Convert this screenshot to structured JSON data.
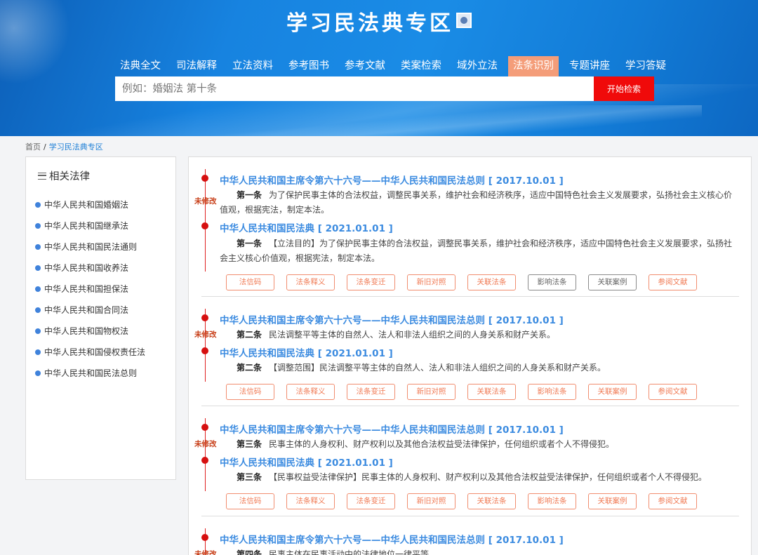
{
  "banner": {
    "title": "学习民法典专区",
    "nav": [
      "法典全文",
      "司法解释",
      "立法资料",
      "参考图书",
      "参考文献",
      "类案检索",
      "域外立法",
      "法条识别",
      "专题讲座",
      "学习答疑"
    ],
    "active_nav": "法条识别",
    "search_placeholder": "例如：婚姻法 第十条",
    "search_button": "开始检索"
  },
  "colors": {
    "accent": "#1a8ce6",
    "active_nav": "#f49d79",
    "search_button": "#f00a0a",
    "link": "#3b8be0",
    "status": "#c8401a"
  },
  "breadcrumb": {
    "home": "首页",
    "separator": "/",
    "current": "学习民法典专区"
  },
  "sidebar": {
    "title": "相关法律",
    "items": [
      "中华人民共和国婚姻法",
      "中华人民共和国继承法",
      "中华人民共和国民法通则",
      "中华人民共和国收养法",
      "中华人民共和国担保法",
      "中华人民共和国合同法",
      "中华人民共和国物权法",
      "中华人民共和国侵权责任法",
      "中华人民共和国民法总则"
    ]
  },
  "articles": [
    {
      "status": "未修改",
      "old_title": "中华人民共和国主席令第六十六号——中华人民共和国民法总则 [ 2017.10.01 ]",
      "old_article_no": "第一条",
      "old_text": "为了保护民事主体的合法权益，调整民事关系，维护社会和经济秩序，适应中国特色社会主义发展要求，弘扬社会主义核心价值观，根据宪法，制定本法。",
      "new_title": "中华人民共和国民法典 [ 2021.01.01 ]",
      "new_article_no": "第一条",
      "new_text": "【立法目的】为了保护民事主体的合法权益，调整民事关系，维护社会和经济秩序，适应中国特色社会主义发展要求，弘扬社会主义核心价值观，根据宪法，制定本法。",
      "buttons": [
        "法信码",
        "法条释义",
        "法条变迁",
        "新旧对照",
        "关联法条",
        "影响法条",
        "关联案例",
        "参阅文献"
      ]
    },
    {
      "status": "未修改",
      "old_title": "中华人民共和国主席令第六十六号——中华人民共和国民法总则 [ 2017.10.01 ]",
      "old_article_no": "第二条",
      "old_text": "民法调整平等主体的自然人、法人和非法人组织之间的人身关系和财产关系。",
      "new_title": "中华人民共和国民法典 [ 2021.01.01 ]",
      "new_article_no": "第二条",
      "new_text": "【调整范围】民法调整平等主体的自然人、法人和非法人组织之间的人身关系和财产关系。",
      "buttons": [
        "法信码",
        "法条释义",
        "法条变迁",
        "新旧对照",
        "关联法条",
        "影响法条",
        "关联案例",
        "参阅文献"
      ]
    },
    {
      "status": "未修改",
      "old_title": "中华人民共和国主席令第六十六号——中华人民共和国民法总则 [ 2017.10.01 ]",
      "old_article_no": "第三条",
      "old_text": "民事主体的人身权利、财产权利以及其他合法权益受法律保护，任何组织或者个人不得侵犯。",
      "new_title": "中华人民共和国民法典 [ 2021.01.01 ]",
      "new_article_no": "第三条",
      "new_text": "【民事权益受法律保护】民事主体的人身权利、财产权利以及其他合法权益受法律保护，任何组织或者个人不得侵犯。",
      "buttons": [
        "法信码",
        "法条释义",
        "法条变迁",
        "新旧对照",
        "关联法条",
        "影响法条",
        "关联案例",
        "参阅文献"
      ]
    },
    {
      "status": "未修改",
      "old_title": "中华人民共和国主席令第六十六号——中华人民共和国民法总则 [ 2017.10.01 ]",
      "old_article_no": "第四条",
      "old_text": "民事主体在民事活动中的法律地位一律平等。"
    }
  ]
}
